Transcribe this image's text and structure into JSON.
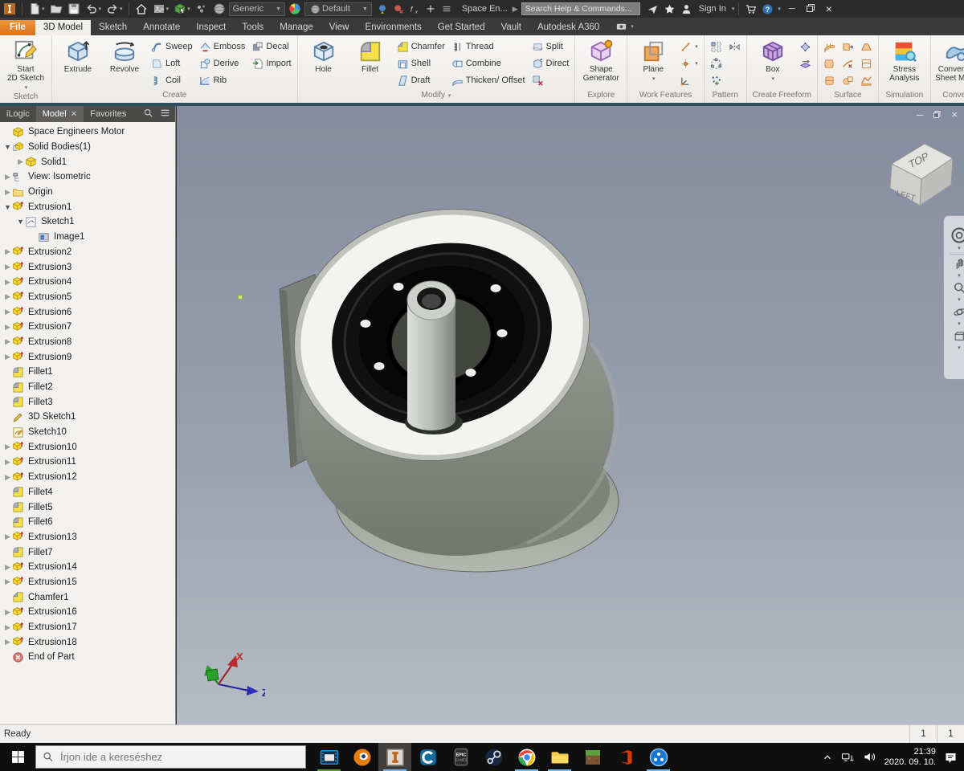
{
  "titlebar": {
    "qat_icons": [
      "inventor-logo",
      "new-file",
      "open",
      "save",
      "undo",
      "redo",
      "home",
      "render-image",
      "select",
      "material",
      "appearance-sphere"
    ],
    "material_dropdown": "Generic",
    "appearance_dropdown": "Default",
    "extra_icons": [
      "adjust-appearance",
      "clear-appearance",
      "parameters-fx",
      "add",
      "menu"
    ],
    "doc_title": "Space En...",
    "search_placeholder": "Search Help & Commands...",
    "right_icons": [
      "share",
      "favorites-star",
      "user"
    ],
    "sign_in": "Sign In",
    "right_icons2": [
      "store-cart",
      "help"
    ],
    "window_controls": [
      "minimize",
      "restore",
      "close"
    ]
  },
  "ribbon_tabs": {
    "items": [
      "File",
      "3D Model",
      "Sketch",
      "Annotate",
      "Inspect",
      "Tools",
      "Manage",
      "View",
      "Environments",
      "Get Started",
      "Vault",
      "Autodesk A360"
    ],
    "active": "3D Model"
  },
  "ribbon": {
    "groups": [
      {
        "label": "Sketch",
        "big": [
          {
            "name": "start-2d-sketch",
            "label": "Start|2D Sketch",
            "icon": "sketch2d",
            "dd": true
          }
        ]
      },
      {
        "label": "Create",
        "big": [
          {
            "name": "extrude",
            "label": "Extrude",
            "icon": "extrude"
          },
          {
            "name": "revolve",
            "label": "Revolve",
            "icon": "revolve"
          }
        ],
        "cols": [
          [
            {
              "name": "sweep",
              "label": "Sweep",
              "icon": "sweep"
            },
            {
              "name": "loft",
              "label": "Loft",
              "icon": "loft"
            },
            {
              "name": "coil",
              "label": "Coil",
              "icon": "coil"
            }
          ],
          [
            {
              "name": "emboss",
              "label": "Emboss",
              "icon": "emboss"
            },
            {
              "name": "derive",
              "label": "Derive",
              "icon": "derive"
            },
            {
              "name": "rib",
              "label": "Rib",
              "icon": "rib"
            }
          ],
          [
            {
              "name": "decal",
              "label": "Decal",
              "icon": "decal"
            },
            {
              "name": "import",
              "label": "Import",
              "icon": "import"
            }
          ]
        ]
      },
      {
        "label": "Modify",
        "dd": true,
        "big": [
          {
            "name": "hole",
            "label": "Hole",
            "icon": "hole"
          },
          {
            "name": "fillet",
            "label": "Fillet",
            "icon": "fillet"
          }
        ],
        "cols": [
          [
            {
              "name": "chamfer",
              "label": "Chamfer",
              "icon": "chamfer"
            },
            {
              "name": "shell",
              "label": "Shell",
              "icon": "shell"
            },
            {
              "name": "draft",
              "label": "Draft",
              "icon": "draft"
            }
          ],
          [
            {
              "name": "thread",
              "label": "Thread",
              "icon": "thread"
            },
            {
              "name": "combine",
              "label": "Combine",
              "icon": "combine"
            },
            {
              "name": "thicken-offset",
              "label": "Thicken/ Offset",
              "icon": "thicken"
            }
          ],
          [
            {
              "name": "split",
              "label": "Split",
              "icon": "split"
            },
            {
              "name": "direct",
              "label": "Direct",
              "icon": "direct"
            },
            {
              "name": "delete-face",
              "label": "",
              "icon": "delface"
            }
          ]
        ]
      },
      {
        "label": "Explore",
        "big": [
          {
            "name": "shape-generator",
            "label": "Shape|Generator",
            "icon": "shapegen"
          }
        ]
      },
      {
        "label": "Work Features",
        "big": [
          {
            "name": "plane",
            "label": "Plane",
            "icon": "plane",
            "dd": true
          }
        ],
        "cols": [
          [
            {
              "name": "axis",
              "label": "",
              "icon": "axis",
              "dd": true
            },
            {
              "name": "point",
              "label": "",
              "icon": "point",
              "dd": true
            },
            {
              "name": "ucs",
              "label": "",
              "icon": "ucs"
            }
          ]
        ]
      },
      {
        "label": "Pattern",
        "cols": [
          [
            {
              "name": "rectangular-pattern",
              "label": "",
              "icon": "patrect"
            },
            {
              "name": "circular-pattern",
              "label": "",
              "icon": "patcirc"
            },
            {
              "name": "sketch-driven-pattern",
              "label": "",
              "icon": "patsketch"
            }
          ],
          [
            {
              "name": "mirror",
              "label": "",
              "icon": "mirror"
            }
          ]
        ]
      },
      {
        "label": "Create Freeform",
        "big": [
          {
            "name": "box",
            "label": "Box",
            "icon": "freeformbox",
            "dd": true
          }
        ],
        "cols": [
          [
            {
              "name": "freeform-face",
              "label": "",
              "icon": "ffface"
            },
            {
              "name": "freeform-convert",
              "label": "",
              "icon": "ffconv"
            }
          ]
        ]
      },
      {
        "label": "Surface",
        "cols": [
          [
            {
              "name": "stitch-surface",
              "label": "",
              "icon": "surf1"
            },
            {
              "name": "boundary-patch",
              "label": "",
              "icon": "surf2"
            },
            {
              "name": "sculpt",
              "label": "",
              "icon": "surf3"
            }
          ],
          [
            {
              "name": "extend-surface",
              "label": "",
              "icon": "surf4"
            },
            {
              "name": "trim-surface",
              "label": "",
              "icon": "surf5"
            },
            {
              "name": "replace-face",
              "label": "",
              "icon": "surf6"
            }
          ],
          [
            {
              "name": "ruled-surface",
              "label": "",
              "icon": "surf7"
            },
            {
              "name": "patch-surface",
              "label": "",
              "icon": "surf8"
            },
            {
              "name": "fit-mesh-face",
              "label": "",
              "icon": "surf9"
            }
          ]
        ]
      },
      {
        "label": "Simulation",
        "big": [
          {
            "name": "stress-analysis",
            "label": "Stress|Analysis",
            "icon": "stress"
          }
        ]
      },
      {
        "label": "Convert",
        "big": [
          {
            "name": "convert-to-sheet-metal",
            "label": "Convert to|Sheet Metal",
            "icon": "sheetmetal"
          }
        ]
      }
    ]
  },
  "browser": {
    "tabs": [
      {
        "label": "iLogic"
      },
      {
        "label": "Model",
        "active": true,
        "closable": true
      },
      {
        "label": "Favorites"
      }
    ],
    "tree": [
      {
        "d": 0,
        "icon": "part",
        "label": "Space Engineers Motor",
        "exp": ""
      },
      {
        "d": 0,
        "icon": "solidbodies",
        "label": "Solid Bodies(1)",
        "exp": "open"
      },
      {
        "d": 1,
        "icon": "solid",
        "label": "Solid1",
        "exp": "closed"
      },
      {
        "d": 0,
        "icon": "view",
        "label": "View: Isometric",
        "exp": "closed"
      },
      {
        "d": 0,
        "icon": "folder",
        "label": "Origin",
        "exp": "closed"
      },
      {
        "d": 0,
        "icon": "extrusion",
        "label": "Extrusion1",
        "exp": "open"
      },
      {
        "d": 1,
        "icon": "sketch",
        "label": "Sketch1",
        "exp": "open"
      },
      {
        "d": 2,
        "icon": "image",
        "label": "Image1",
        "exp": ""
      },
      {
        "d": 0,
        "icon": "extrusion",
        "label": "Extrusion2",
        "exp": "closed"
      },
      {
        "d": 0,
        "icon": "extrusion",
        "label": "Extrusion3",
        "exp": "closed"
      },
      {
        "d": 0,
        "icon": "extrusion",
        "label": "Extrusion4",
        "exp": "closed"
      },
      {
        "d": 0,
        "icon": "extrusion",
        "label": "Extrusion5",
        "exp": "closed"
      },
      {
        "d": 0,
        "icon": "extrusion",
        "label": "Extrusion6",
        "exp": "closed"
      },
      {
        "d": 0,
        "icon": "extrusion",
        "label": "Extrusion7",
        "exp": "closed"
      },
      {
        "d": 0,
        "icon": "extrusion",
        "label": "Extrusion8",
        "exp": "closed"
      },
      {
        "d": 0,
        "icon": "extrusion",
        "label": "Extrusion9",
        "exp": "closed"
      },
      {
        "d": 0,
        "icon": "fillet",
        "label": "Fillet1",
        "exp": ""
      },
      {
        "d": 0,
        "icon": "fillet",
        "label": "Fillet2",
        "exp": ""
      },
      {
        "d": 0,
        "icon": "fillet",
        "label": "Fillet3",
        "exp": ""
      },
      {
        "d": 0,
        "icon": "sketch3d",
        "label": "3D Sketch1",
        "exp": ""
      },
      {
        "d": 0,
        "icon": "sketchpage",
        "label": "Sketch10",
        "exp": ""
      },
      {
        "d": 0,
        "icon": "extrusion",
        "label": "Extrusion10",
        "exp": "closed"
      },
      {
        "d": 0,
        "icon": "extrusion",
        "label": "Extrusion11",
        "exp": "closed"
      },
      {
        "d": 0,
        "icon": "extrusion",
        "label": "Extrusion12",
        "exp": "closed"
      },
      {
        "d": 0,
        "icon": "fillet",
        "label": "Fillet4",
        "exp": ""
      },
      {
        "d": 0,
        "icon": "fillet",
        "label": "Fillet5",
        "exp": ""
      },
      {
        "d": 0,
        "icon": "fillet",
        "label": "Fillet6",
        "exp": ""
      },
      {
        "d": 0,
        "icon": "extrusion",
        "label": "Extrusion13",
        "exp": "closed"
      },
      {
        "d": 0,
        "icon": "fillet",
        "label": "Fillet7",
        "exp": ""
      },
      {
        "d": 0,
        "icon": "extrusion",
        "label": "Extrusion14",
        "exp": "closed"
      },
      {
        "d": 0,
        "icon": "extrusion",
        "label": "Extrusion15",
        "exp": "closed"
      },
      {
        "d": 0,
        "icon": "chamfer",
        "label": "Chamfer1",
        "exp": ""
      },
      {
        "d": 0,
        "icon": "extrusion",
        "label": "Extrusion16",
        "exp": "closed"
      },
      {
        "d": 0,
        "icon": "extrusion",
        "label": "Extrusion17",
        "exp": "closed"
      },
      {
        "d": 0,
        "icon": "extrusion",
        "label": "Extrusion18",
        "exp": "closed"
      },
      {
        "d": 0,
        "icon": "endofpart",
        "label": "End of Part",
        "exp": ""
      }
    ]
  },
  "viewport": {
    "viewcube_faces": {
      "top": "TOP",
      "left": "LEFT"
    },
    "axis_labels": {
      "x": "X",
      "z": "Z"
    },
    "navbar_icons": [
      "navigation-wheel",
      "pan",
      "zoom",
      "orbit",
      "look-at"
    ]
  },
  "statusbar": {
    "left": "Ready",
    "cells": [
      "1",
      "1"
    ]
  },
  "taskbar": {
    "search_placeholder": "Írjon ide a kereséshez",
    "apps": [
      {
        "name": "movies-tv",
        "underline": "#5c9e31",
        "active": false
      },
      {
        "name": "blender",
        "underline": "",
        "active": false
      },
      {
        "name": "inventor",
        "underline": "#76b9ed",
        "active": true
      },
      {
        "name": "cura",
        "underline": "",
        "active": false
      },
      {
        "name": "epic-games",
        "underline": "",
        "active": false
      },
      {
        "name": "steam",
        "underline": "",
        "active": false
      },
      {
        "name": "chrome",
        "underline": "#76b9ed",
        "active": false
      },
      {
        "name": "file-explorer",
        "underline": "#76b9ed",
        "active": false
      },
      {
        "name": "minecraft",
        "underline": "",
        "active": false
      },
      {
        "name": "office",
        "underline": "",
        "active": false
      },
      {
        "name": "blue-app",
        "underline": "#76b9ed",
        "active": false
      }
    ],
    "tray": {
      "time": "21:39",
      "date": "2020. 09. 10."
    }
  }
}
